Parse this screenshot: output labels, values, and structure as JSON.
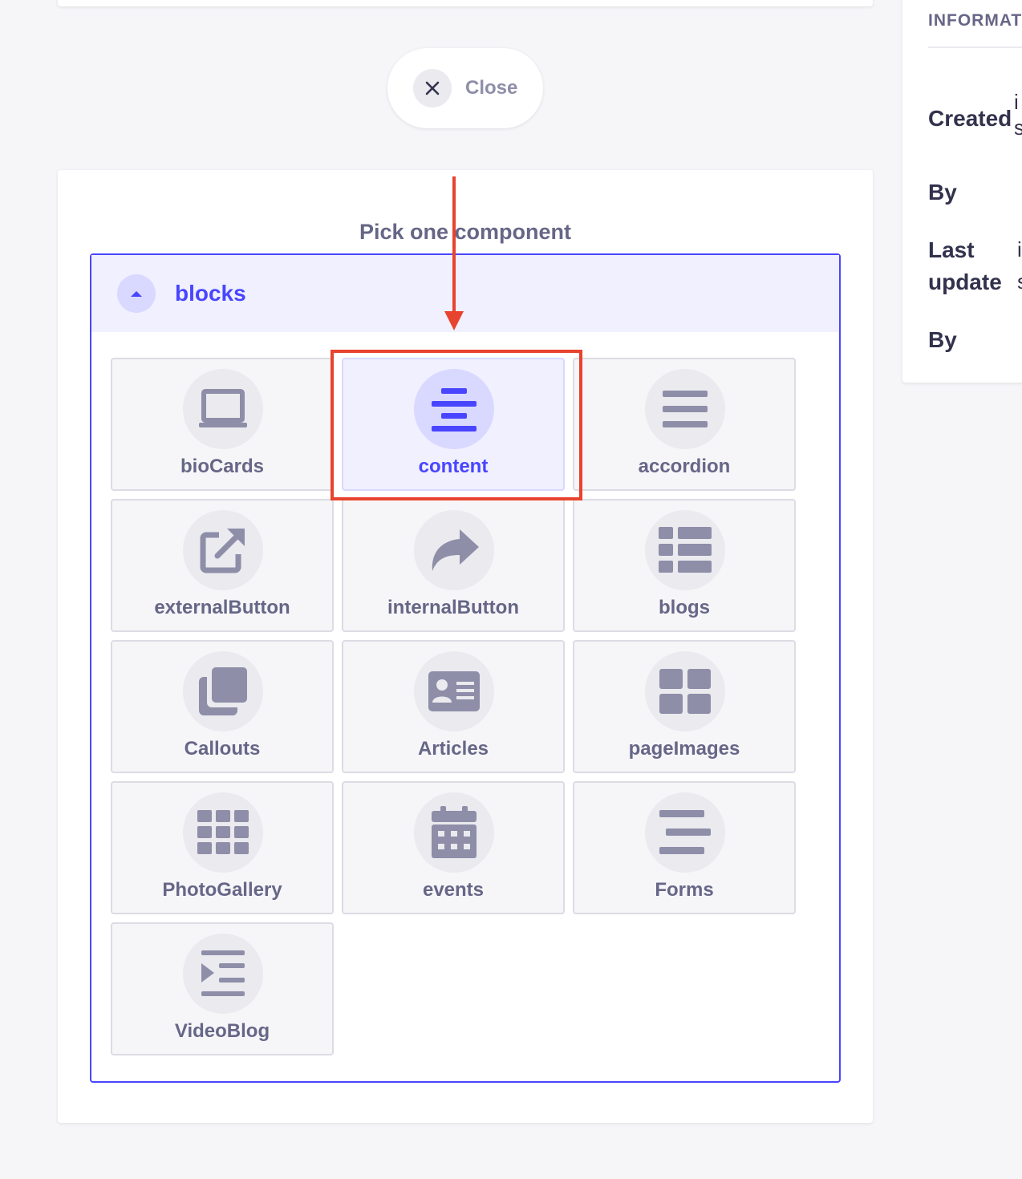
{
  "close_button": {
    "label": "Close",
    "icon": "close-icon"
  },
  "picker": {
    "title": "Pick one component",
    "category": {
      "label": "blocks",
      "icon": "chevron-up-icon",
      "components": [
        {
          "label": "bioCards",
          "icon": "laptop-icon",
          "selected": false
        },
        {
          "label": "content",
          "icon": "align-center-icon",
          "selected": true
        },
        {
          "label": "accordion",
          "icon": "bars-icon",
          "selected": false
        },
        {
          "label": "externalButton",
          "icon": "external-link-icon",
          "selected": false
        },
        {
          "label": "internalButton",
          "icon": "share-arrow-icon",
          "selected": false
        },
        {
          "label": "blogs",
          "icon": "list-icon",
          "selected": false
        },
        {
          "label": "Callouts",
          "icon": "copy-icon",
          "selected": false
        },
        {
          "label": "Articles",
          "icon": "id-card-icon",
          "selected": false
        },
        {
          "label": "pageImages",
          "icon": "th-large-icon",
          "selected": false
        },
        {
          "label": "PhotoGallery",
          "icon": "th-icon",
          "selected": false
        },
        {
          "label": "events",
          "icon": "calendar-icon",
          "selected": false
        },
        {
          "label": "Forms",
          "icon": "align-left-icon",
          "selected": false
        },
        {
          "label": "VideoBlog",
          "icon": "indent-icon",
          "selected": false
        }
      ]
    }
  },
  "info_panel": {
    "title": "INFORMAT",
    "created_label": "Created",
    "created_by_label": "By",
    "last_update_label": "Last update",
    "last_update_by_label": "By",
    "created_value_frag_1": "i",
    "created_value_frag_2": "s",
    "update_value_frag_1": "i",
    "update_value_frag_2": "s"
  },
  "colors": {
    "accent": "#4945ff",
    "accent_light": "#f0f0ff",
    "neutral_text": "#666687",
    "annotation": "#e8432e"
  }
}
